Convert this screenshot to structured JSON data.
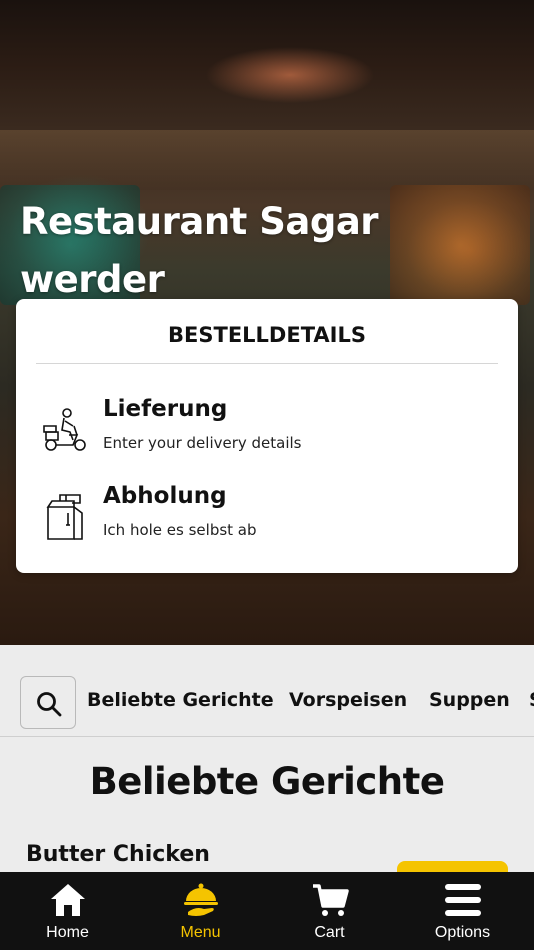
{
  "hero": {
    "title": "Restaurant Sagar werder"
  },
  "order_modal": {
    "title": "BESTELLDETAILS",
    "options": [
      {
        "title": "Lieferung",
        "subtitle": "Enter your delivery details",
        "icon": "delivery-scooter-icon"
      },
      {
        "title": "Abholung",
        "subtitle": "Ich hole es selbst ab",
        "icon": "takeaway-bag-icon"
      }
    ]
  },
  "categories": {
    "search_icon": "search-icon",
    "items": [
      "Beliebte Gerichte",
      "Vorspeisen",
      "Suppen",
      "S"
    ]
  },
  "section": {
    "title": "Beliebte Gerichte",
    "first_dish": "Butter Chicken"
  },
  "bottom_nav": {
    "items": [
      {
        "label": "Home",
        "icon": "home-icon"
      },
      {
        "label": "Menu",
        "icon": "menu-cloche-icon",
        "active": true
      },
      {
        "label": "Cart",
        "icon": "cart-icon"
      },
      {
        "label": "Options",
        "icon": "hamburger-icon"
      }
    ]
  },
  "colors": {
    "accent": "#f5c400",
    "nav_bg": "#111111",
    "page_bg": "#ececec"
  }
}
